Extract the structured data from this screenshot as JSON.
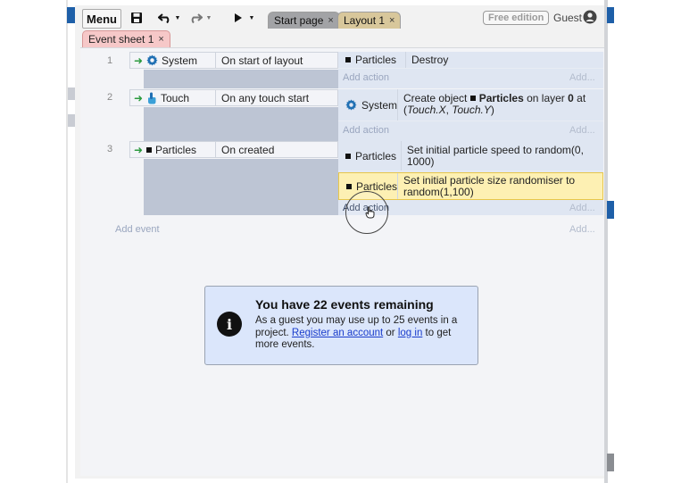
{
  "toolbar": {
    "menu_label": "Menu",
    "tabs": [
      {
        "label": "Start page",
        "close": "×"
      },
      {
        "label": "Layout 1",
        "close": "×"
      }
    ],
    "edition_badge": "Free edition",
    "user_label": "Guest"
  },
  "sheet_tab": {
    "label": "Event sheet 1",
    "close": "×"
  },
  "events": [
    {
      "number": "1",
      "condition": {
        "object": "System",
        "text": "On start of layout"
      },
      "actions": [
        {
          "object": "Particles",
          "text": "Destroy"
        }
      ],
      "add_action": "Add action",
      "add_right": "Add..."
    },
    {
      "number": "2",
      "condition": {
        "object": "Touch",
        "text": "On any touch start"
      },
      "actions": [
        {
          "object": "System",
          "text_parts": [
            "Create object ",
            "Particles",
            " on layer ",
            "0",
            " at (",
            "Touch.X",
            ", ",
            "Touch.Y",
            ")"
          ]
        }
      ],
      "add_action": "Add action",
      "add_right": "Add..."
    },
    {
      "number": "3",
      "condition": {
        "object": "Particles",
        "text": "On created"
      },
      "actions": [
        {
          "object": "Particles",
          "text": "Set initial particle speed to random(0, 1000)"
        },
        {
          "object": "Particles",
          "text": "Set initial particle size randomiser to random(1,100)"
        }
      ],
      "add_action": "Add action",
      "add_right": "Add..."
    }
  ],
  "add_event": "Add event",
  "add_event_right": "Add...",
  "notice": {
    "title": "You have 22 events remaining",
    "body_start": "As a guest you may use up to 25 events in a project. ",
    "register_link": "Register an account",
    "body_mid": " or ",
    "login_link": "log in",
    "body_end": " to get more events."
  },
  "colors": {
    "accent_blue": "#1e5fa8",
    "selected_action": "#fdf0b3",
    "notice_bg": "#dbe6fb",
    "sheet_tab": "#f6c8c8"
  }
}
